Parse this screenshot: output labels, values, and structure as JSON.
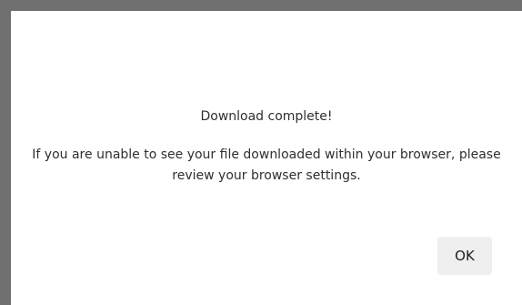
{
  "dialog": {
    "title": "Download complete!",
    "message": "If you are unable to see your file downloaded within your browser, please review your browser settings.",
    "ok_label": "OK"
  }
}
